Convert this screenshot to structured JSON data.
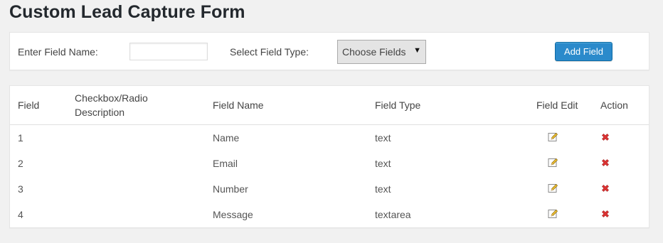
{
  "page": {
    "title": "Custom Lead Capture Form"
  },
  "form": {
    "name_label": "Enter Field Name:",
    "name_value": "",
    "type_label": "Select Field Type:",
    "type_selected": "Choose Fields",
    "add_button_label": "Add Field"
  },
  "table": {
    "headers": {
      "field": "Field",
      "description_line1": "Checkbox/Radio",
      "description_line2": "Description",
      "field_name": "Field Name",
      "field_type": "Field Type",
      "field_edit": "Field Edit",
      "action": "Action"
    },
    "rows": [
      {
        "field": "1",
        "description": "",
        "name": "Name",
        "type": "text"
      },
      {
        "field": "2",
        "description": "",
        "name": "Email",
        "type": "text"
      },
      {
        "field": "3",
        "description": "",
        "name": "Number",
        "type": "text"
      },
      {
        "field": "4",
        "description": "",
        "name": "Message",
        "type": "textarea"
      }
    ]
  },
  "icons": {
    "edit": "pencil-edit-icon",
    "delete": "red-x-delete-icon"
  },
  "colors": {
    "primary_button": "#2b8acb",
    "delete": "#d33",
    "background": "#f1f1f1"
  }
}
